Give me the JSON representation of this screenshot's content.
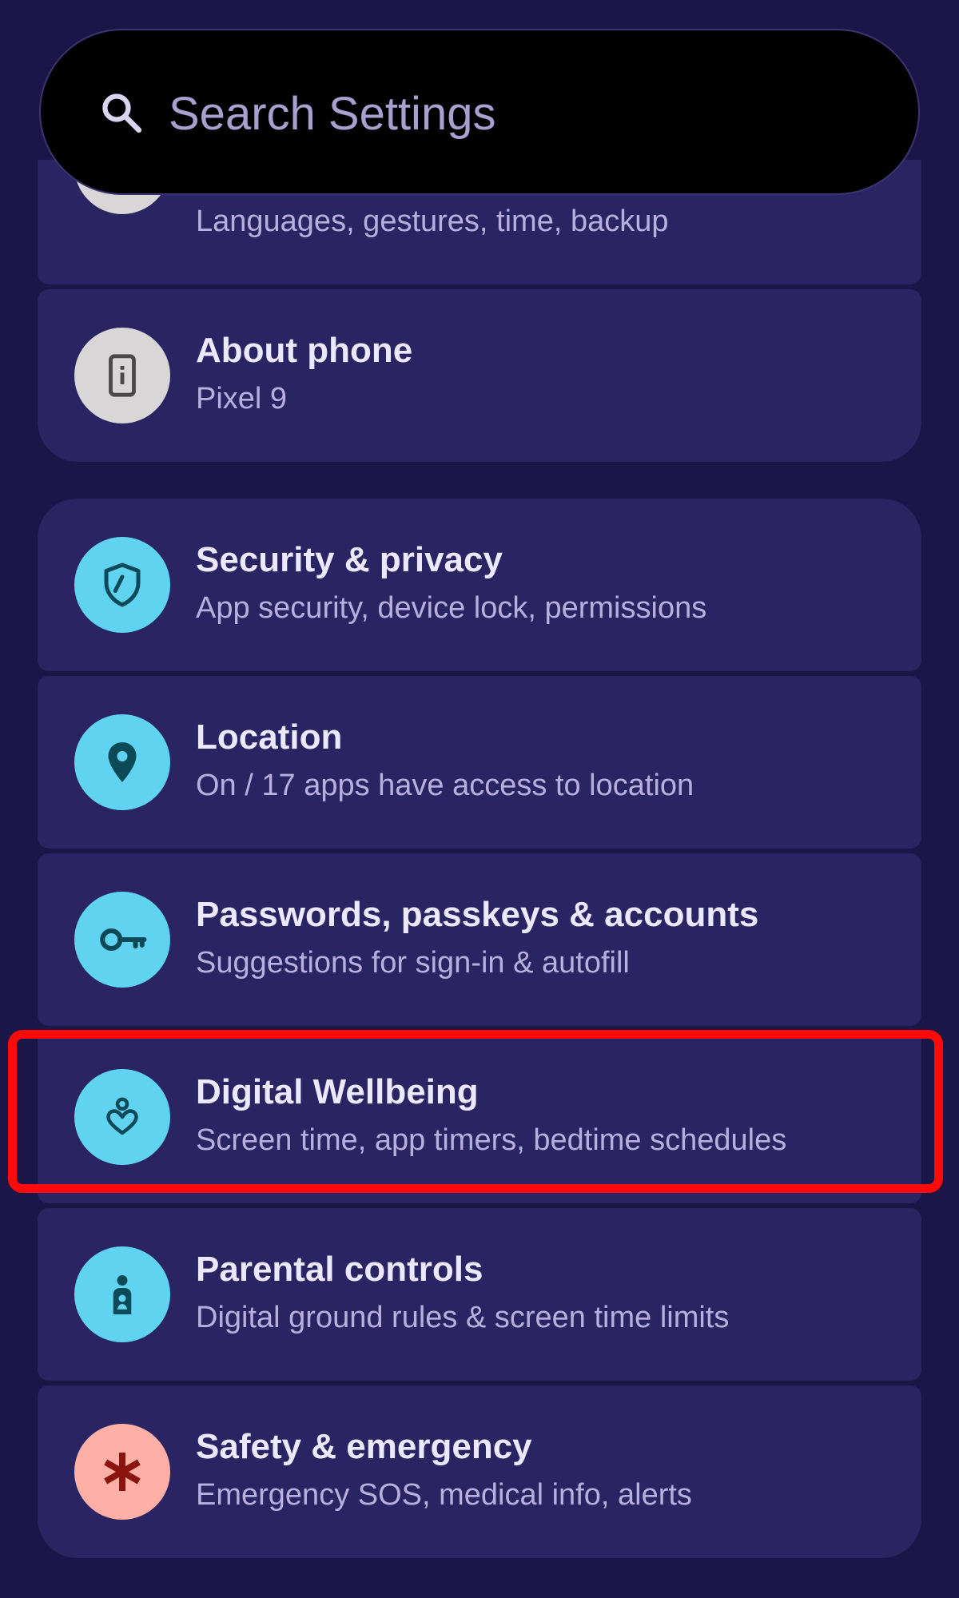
{
  "search": {
    "placeholder": "Search Settings"
  },
  "groups": [
    {
      "items": [
        {
          "name": "system",
          "title": "",
          "subtitle": "Languages, gestures, time, backup",
          "icon": "system-icon",
          "icon_bg": "#d8d6d6"
        },
        {
          "name": "about-phone",
          "title": "About phone",
          "subtitle": "Pixel 9",
          "icon": "phone-info-icon",
          "icon_bg": "#d8d6d6"
        }
      ]
    },
    {
      "items": [
        {
          "name": "security-privacy",
          "title": "Security & privacy",
          "subtitle": "App security, device lock, permissions",
          "icon": "shield-icon",
          "icon_bg": "#5fd3f0"
        },
        {
          "name": "location",
          "title": "Location",
          "subtitle": "On / 17 apps have access to location",
          "icon": "location-pin-icon",
          "icon_bg": "#5fd3f0"
        },
        {
          "name": "passwords-accounts",
          "title": "Passwords, passkeys & accounts",
          "subtitle": "Suggestions for sign-in & autofill",
          "icon": "key-icon",
          "icon_bg": "#5fd3f0"
        },
        {
          "name": "digital-wellbeing",
          "title": "Digital Wellbeing",
          "subtitle": "Screen time, app timers, bedtime schedules",
          "icon": "wellbeing-heart-icon",
          "icon_bg": "#5fd3f0"
        },
        {
          "name": "parental-controls",
          "title": "Parental controls",
          "subtitle": "Digital ground rules & screen time limits",
          "icon": "parent-child-icon",
          "icon_bg": "#5fd3f0"
        },
        {
          "name": "safety-emergency",
          "title": "Safety & emergency",
          "subtitle": "Emergency SOS, medical info, alerts",
          "icon": "asterisk-icon",
          "icon_bg": "#ffb0a6"
        }
      ]
    }
  ],
  "highlight": {
    "target": "digital-wellbeing",
    "color": "#ff0a0a"
  },
  "colors": {
    "background": "#1c1648",
    "card": "#2b2463",
    "title_text": "#ece8ff",
    "subtitle_text": "#b7b0de",
    "icon_dark_teal": "#0d4a57",
    "icon_dark_grey": "#4a4848",
    "icon_dark_red": "#8a1410"
  }
}
